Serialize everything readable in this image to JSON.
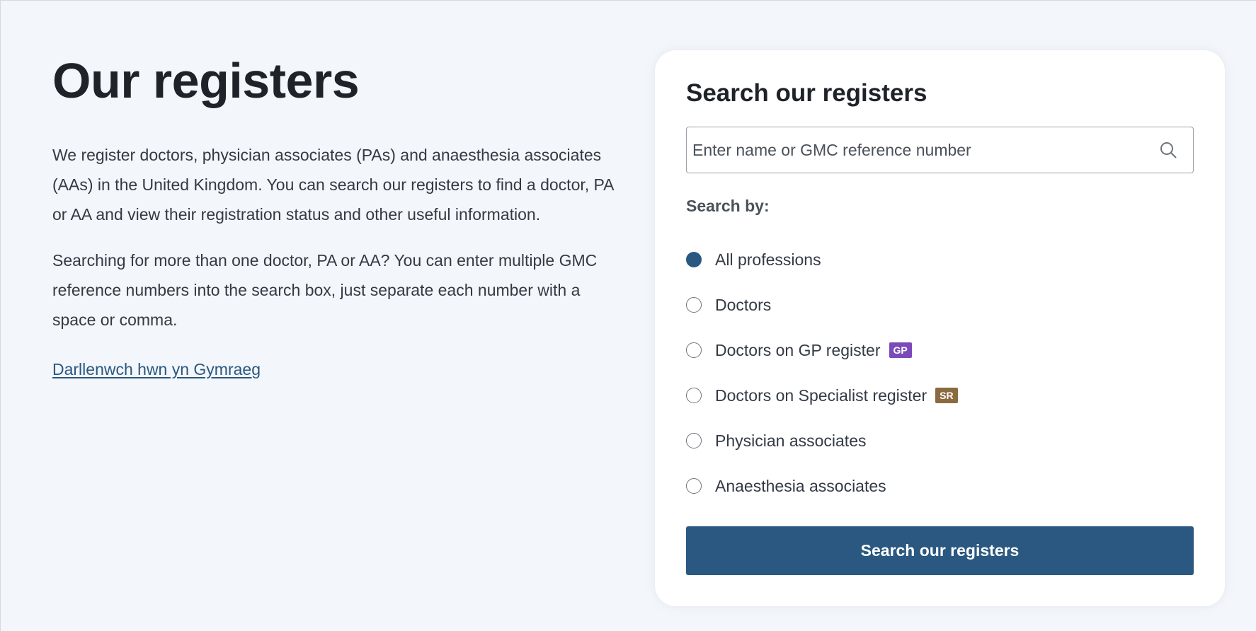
{
  "page": {
    "title": "Our registers",
    "intro_paragraphs": [
      "We register doctors, physician associates (PAs) and anaesthesia associates (AAs) in the United Kingdom. You can search our registers to find a doctor, PA or AA and view their registration status and other useful information.",
      "Searching for more than one doctor, PA or AA? You can enter multiple GMC reference numbers into the search box, just separate each number with a space or comma."
    ],
    "welsh_link": "Darllenwch hwn yn Gymraeg"
  },
  "search": {
    "title": "Search our registers",
    "input_value": "",
    "placeholder": "Enter name or GMC reference number",
    "icon": "search-icon",
    "search_by_label": "Search by:",
    "options": [
      {
        "label": "All professions",
        "selected": true
      },
      {
        "label": "Doctors",
        "selected": false
      },
      {
        "label": "Doctors on GP register",
        "selected": false,
        "badge": "GP"
      },
      {
        "label": "Doctors on Specialist register",
        "selected": false,
        "badge": "SR"
      },
      {
        "label": "Physician associates",
        "selected": false
      },
      {
        "label": "Anaesthesia associates",
        "selected": false
      }
    ],
    "submit_label": "Search our registers"
  },
  "colors": {
    "background": "#f3f6fa",
    "accent": "#2a5880",
    "gp_badge": "#7a4bb8",
    "sr_badge": "#8a6a3f",
    "card": "#ffffff"
  }
}
